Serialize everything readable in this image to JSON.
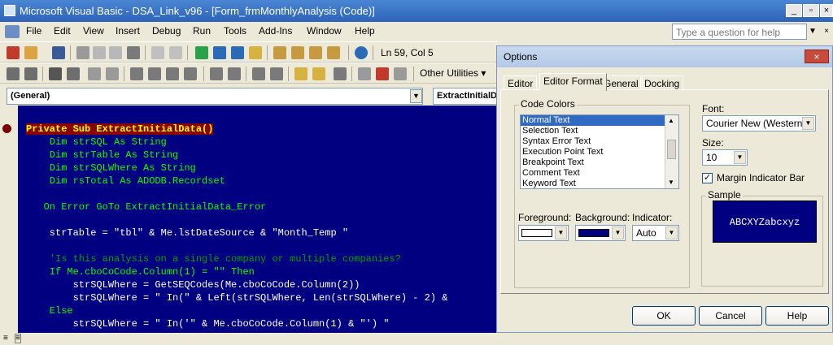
{
  "window": {
    "title": "Microsoft Visual Basic - DSA_Link_v96 - [Form_frmMonthlyAnalysis (Code)]"
  },
  "menu": {
    "items": [
      "File",
      "Edit",
      "View",
      "Insert",
      "Debug",
      "Run",
      "Tools",
      "Add-Ins",
      "Window",
      "Help"
    ]
  },
  "help": {
    "placeholder": "Type a question for help"
  },
  "toolbar": {
    "position": "Ln 59, Col 5",
    "other_utilities": "Other Utilities"
  },
  "combos": {
    "object": "(General)",
    "procedure": "ExtractInitialData"
  },
  "code": {
    "lines": [
      {
        "text": "Private Sub ExtractInitialData()",
        "style": "hl"
      },
      {
        "text": "    Dim strSQL As String",
        "style": "kw"
      },
      {
        "text": "    Dim strTable As String",
        "style": "kw"
      },
      {
        "text": "    Dim strSQLWhere As String",
        "style": "kw"
      },
      {
        "text": "    Dim rsTotal As ADODB.Recordset",
        "style": "kw"
      },
      {
        "text": "",
        "style": "kw"
      },
      {
        "text": "   On Error GoTo ExtractInitialData_Error",
        "style": "mix1"
      },
      {
        "text": "",
        "style": "kw"
      },
      {
        "text": "    strTable = \"tbl\" & Me.lstDateSource & \"Month_Temp \"",
        "style": "mix2"
      },
      {
        "text": "",
        "style": "kw"
      },
      {
        "text": "    'Is this analysis on a single company or multiple companies?",
        "style": "cm"
      },
      {
        "text": "    If Me.cboCoCode.Column(1) = \"\" Then",
        "style": "mix3"
      },
      {
        "text": "        strSQLWhere = GetSEQCodes(Me.cboCoCode.Column(2))",
        "style": "mix4"
      },
      {
        "text": "        strSQLWhere = \" In(\" & Left(strSQLWhere, Len(strSQLWhere) - 2) &",
        "style": "mix5"
      },
      {
        "text": "    Else",
        "style": "kw"
      },
      {
        "text": "        strSQLWhere = \" In('\" & Me.cboCoCode.Column(1) & \"') \"",
        "style": "mix6"
      }
    ]
  },
  "dialog": {
    "title": "Options",
    "tabs": [
      "Editor",
      "Editor Format",
      "General",
      "Docking"
    ],
    "active_tab": "Editor Format",
    "code_colors_label": "Code Colors",
    "code_colors": [
      "Normal Text",
      "Selection Text",
      "Syntax Error Text",
      "Execution Point Text",
      "Breakpoint Text",
      "Comment Text",
      "Keyword Text"
    ],
    "selected_color": "Normal Text",
    "foreground_label": "Foreground:",
    "background_label": "Background:",
    "indicator_label": "Indicator:",
    "indicator_value": "Auto",
    "font_label": "Font:",
    "font_value": "Courier New (Western)",
    "size_label": "Size:",
    "size_value": "10",
    "margin_indicator_label": "Margin Indicator Bar",
    "margin_indicator_checked": true,
    "sample_label": "Sample",
    "sample_text": "ABCXYZabcxyz",
    "ok": "OK",
    "cancel": "Cancel",
    "help": "Help"
  },
  "colors": {
    "code_bg": "#000080",
    "code_fg": "#00ff00",
    "highlight_bg": "#8b0000",
    "highlight_fg": "#ffff00",
    "selection": "#316ac5"
  }
}
